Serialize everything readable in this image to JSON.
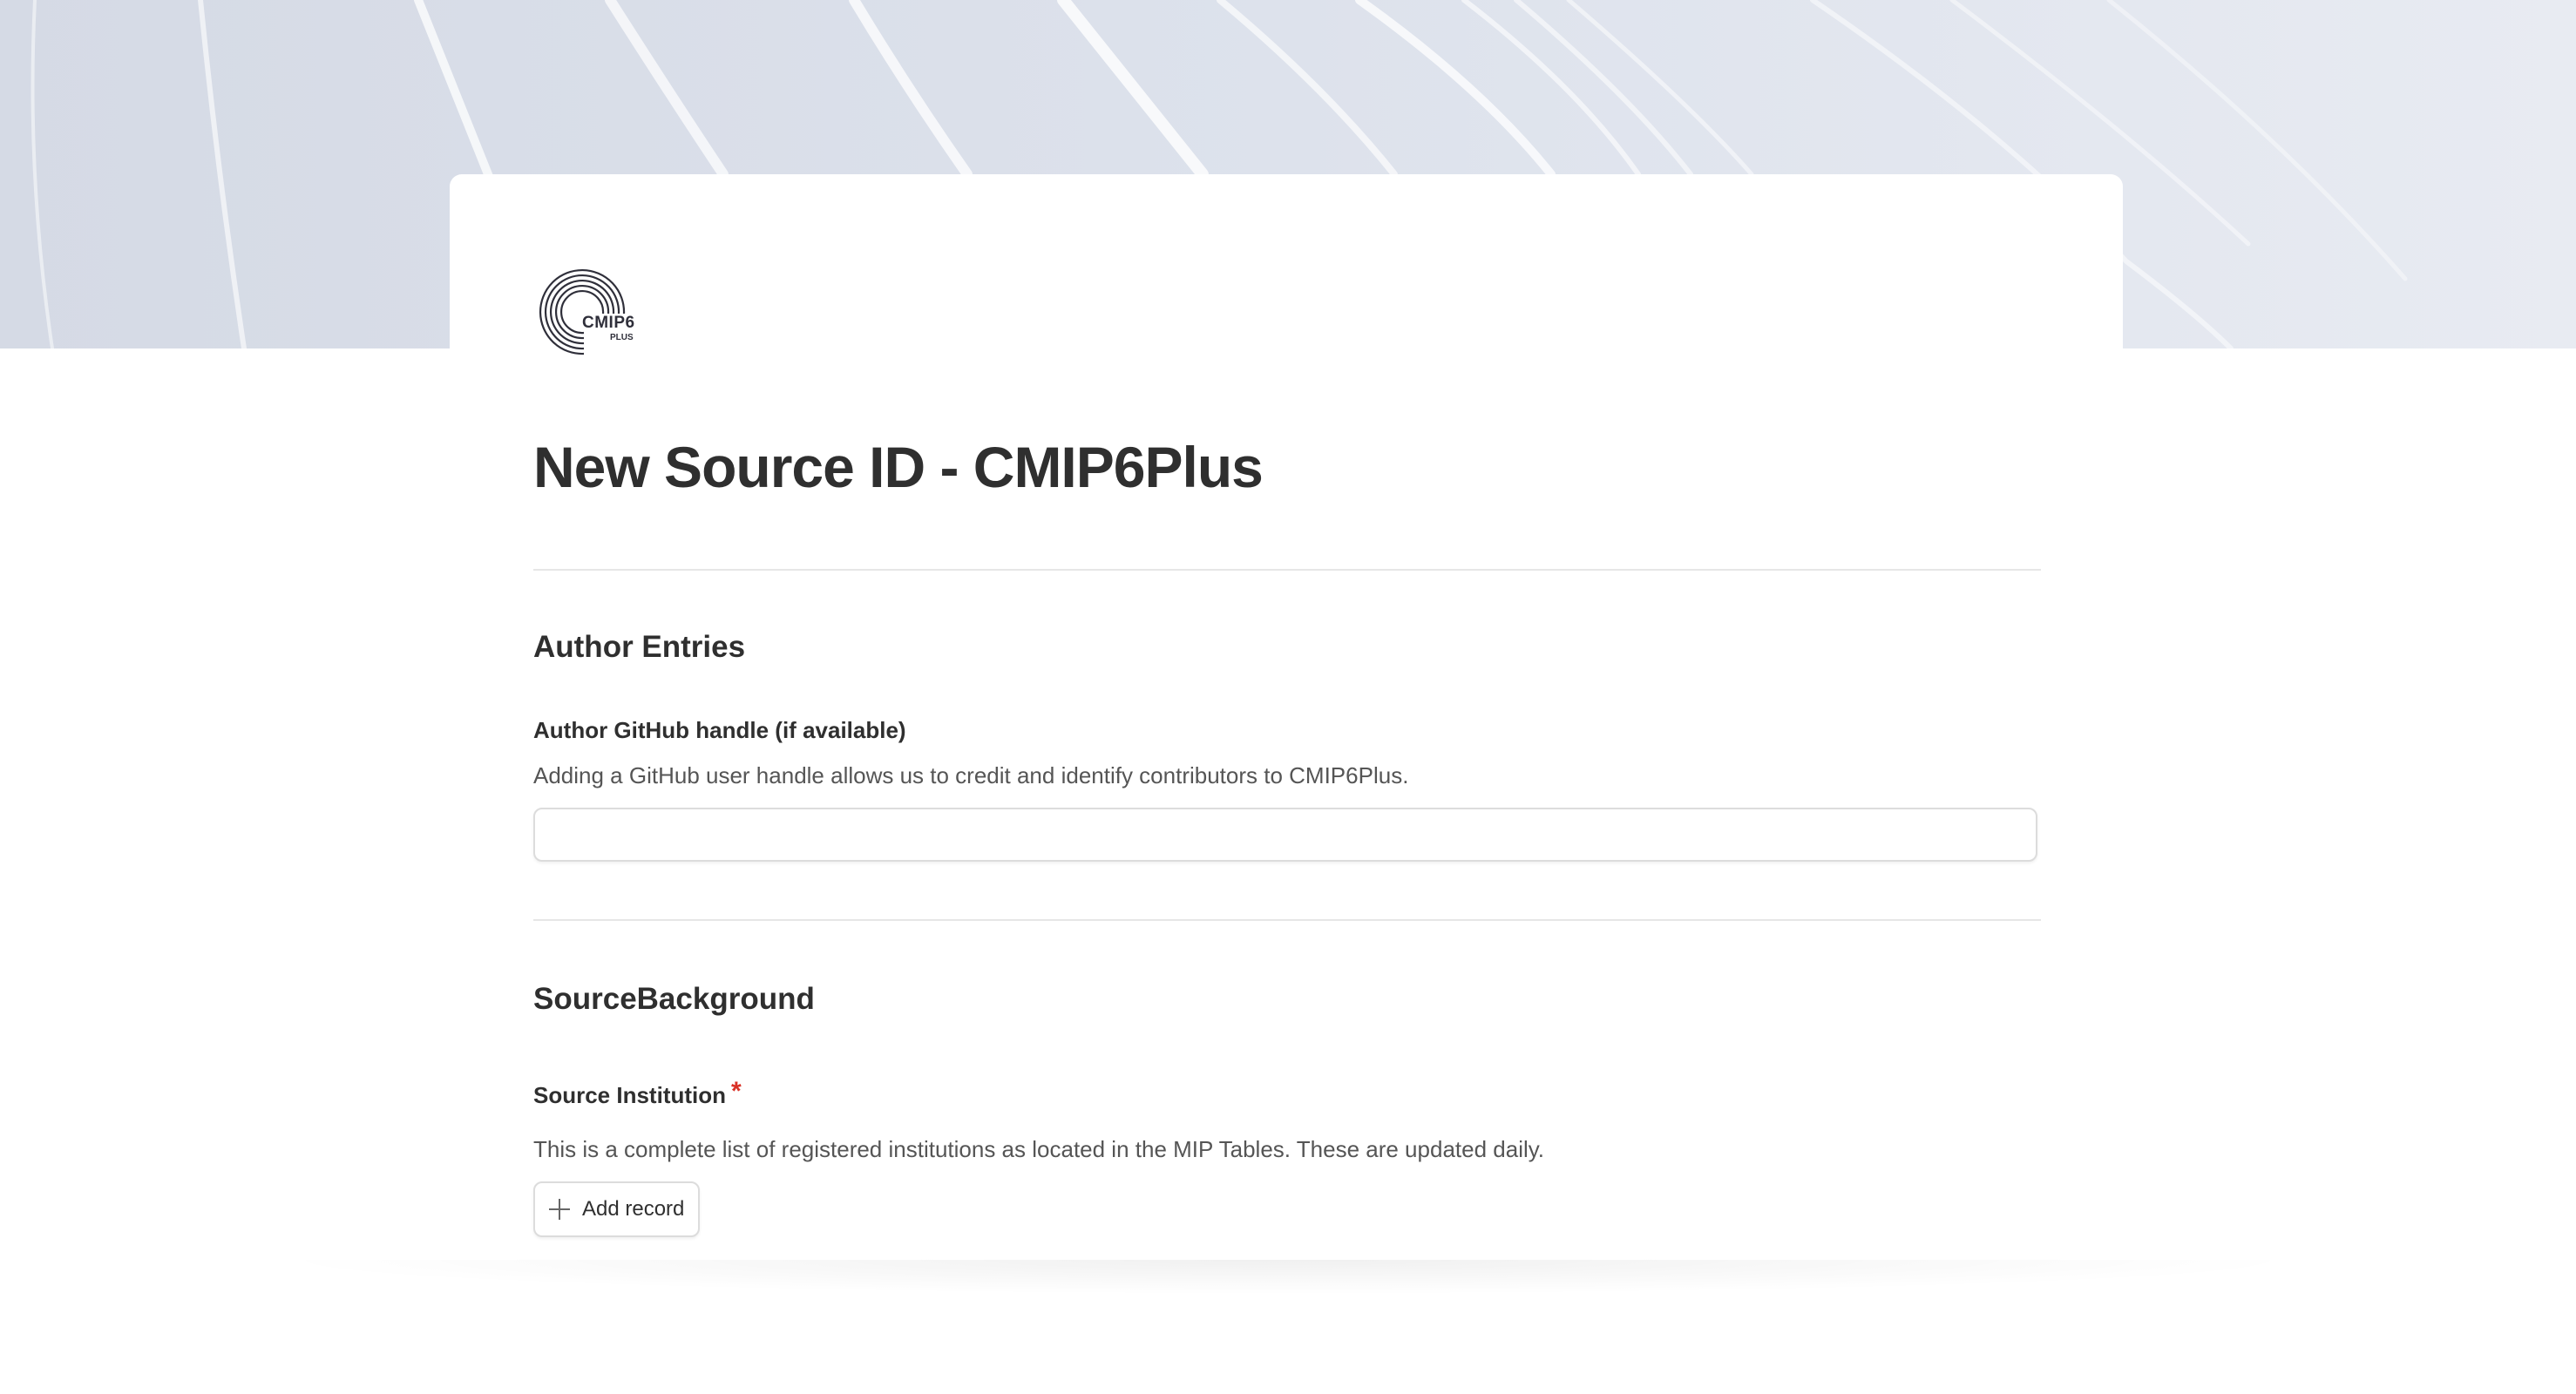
{
  "form": {
    "logo": {
      "name": "CMIP6",
      "sub": "PLUS"
    },
    "title": "New Source ID - CMIP6Plus",
    "sections": [
      {
        "title": "Author Entries",
        "fields": [
          {
            "label": "Author GitHub handle (if available)",
            "description": "Adding a GitHub user handle allows us to credit and identify contributors to CMIP6Plus.",
            "value": "",
            "placeholder": ""
          }
        ]
      },
      {
        "title": "SourceBackground",
        "fields": [
          {
            "label": "Source Institution",
            "required_mark": "*",
            "description": "This is a complete list of registered institutions as located in the MIP Tables. These are updated daily.",
            "button_label": "Add record"
          }
        ]
      }
    ]
  },
  "colors": {
    "hero_background": "#dde2ec",
    "required": "#d93025",
    "text": "#2f2f2f"
  },
  "icons": {
    "add_record": "plus-icon",
    "logo": "cmip6-plus-logo"
  }
}
